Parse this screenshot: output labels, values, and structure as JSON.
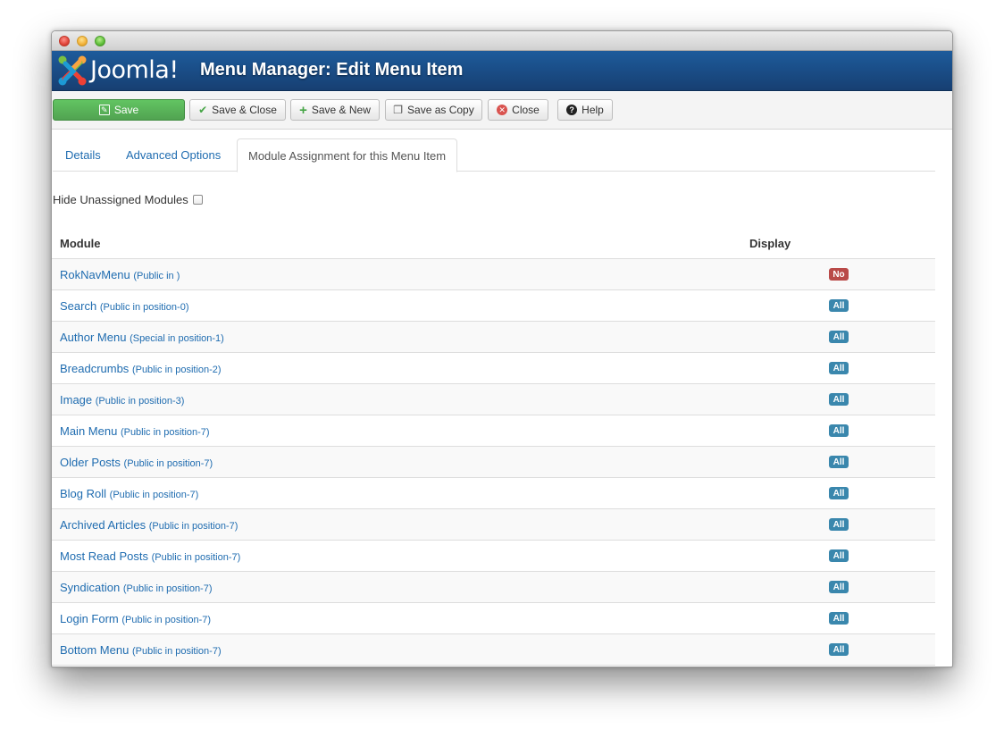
{
  "window": {
    "controls": [
      "close",
      "minimize",
      "zoom"
    ]
  },
  "header": {
    "logo_text": "Joomla!",
    "title": "Menu Manager: Edit Menu Item"
  },
  "toolbar": {
    "save": "Save",
    "save_close": "Save & Close",
    "save_new": "Save & New",
    "save_copy": "Save as Copy",
    "close": "Close",
    "help": "Help"
  },
  "tabs": [
    {
      "label": "Details",
      "active": false
    },
    {
      "label": "Advanced Options",
      "active": false
    },
    {
      "label": "Module Assignment for this Menu Item",
      "active": true
    }
  ],
  "filter": {
    "hide_unassigned_label": "Hide Unassigned Modules",
    "hide_unassigned_checked": false
  },
  "table": {
    "headers": {
      "module": "Module",
      "display": "Display"
    },
    "rows": [
      {
        "name": "RokNavMenu",
        "meta": "(Public in )",
        "display": "No"
      },
      {
        "name": "Search",
        "meta": "(Public in position-0)",
        "display": "All"
      },
      {
        "name": "Author Menu",
        "meta": "(Special in position-1)",
        "display": "All"
      },
      {
        "name": "Breadcrumbs",
        "meta": "(Public in position-2)",
        "display": "All"
      },
      {
        "name": "Image",
        "meta": "(Public in position-3)",
        "display": "All"
      },
      {
        "name": "Main Menu",
        "meta": "(Public in position-7)",
        "display": "All"
      },
      {
        "name": "Older Posts",
        "meta": "(Public in position-7)",
        "display": "All"
      },
      {
        "name": "Blog Roll",
        "meta": "(Public in position-7)",
        "display": "All"
      },
      {
        "name": "Archived Articles",
        "meta": "(Public in position-7)",
        "display": "All"
      },
      {
        "name": "Most Read Posts",
        "meta": "(Public in position-7)",
        "display": "All"
      },
      {
        "name": "Syndication",
        "meta": "(Public in position-7)",
        "display": "All"
      },
      {
        "name": "Login Form",
        "meta": "(Public in position-7)",
        "display": "All"
      },
      {
        "name": "Bottom Menu",
        "meta": "(Public in position-7)",
        "display": "All"
      }
    ]
  },
  "colors": {
    "header_blue": "#1d5b9b",
    "link_blue": "#1f6cb0",
    "primary_green": "#51a351",
    "badge_all": "#3a87ad",
    "badge_no": "#b94a48"
  }
}
